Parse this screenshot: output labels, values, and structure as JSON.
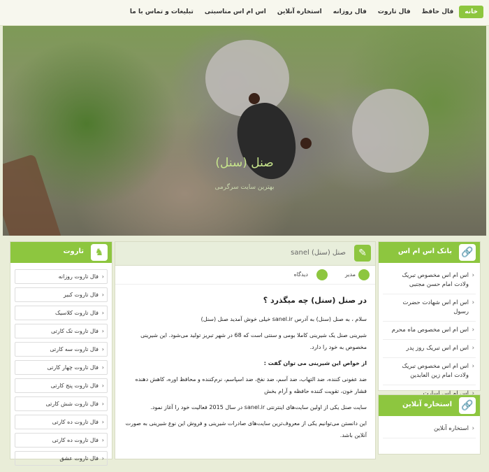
{
  "nav": {
    "items": [
      "خانه",
      "فال حافظ",
      "فال تاروت",
      "فال روزانه",
      "استخاره آنلاین",
      "اس ام اس مناسبتی",
      "تبلیغات و تماس با ما"
    ]
  },
  "hero": {
    "title": "صنل (سنل)",
    "subtitle": "بهترین سایت سرگرمی"
  },
  "right_panel_1": {
    "title": "بانک اس ام اس",
    "items": [
      "اس ام اس مخصوص تبریک ولادت امام حسن مجتبی",
      "اس ام اس شهادت حضرت رسول",
      "اس ام اس مخصوص ماه محرم",
      "اس ام اس تبریک روز پدر",
      "اس ام اس مخصوص تبریک ولادت امام زین العابدین",
      "اس ام اس اسارت"
    ]
  },
  "right_panel_2": {
    "title": "استخاره آنلاین",
    "items": [
      "استخاره آنلاین"
    ]
  },
  "left_panel": {
    "title": "تاروت",
    "items": [
      "فال تاروت روزانه",
      "فال تاروت کبیر",
      "فال تاروت کلاسیک",
      "فال تاروت تک کارتی",
      "فال تاروت سه کارتی",
      "فال تاروت چهار کارتی",
      "فال تاروت پنج کارتی",
      "فال تاروت شش کارتی",
      "فال تاروت ده کارتی",
      "فال تاروت ده کارتی",
      "فال تاروت عشق"
    ]
  },
  "post": {
    "header_title": "صنل (سنل) sanel",
    "author": "مدیر",
    "comments": "دیدگاه",
    "heading": "در صنل (سنل) چه میگذرد ؟",
    "paragraphs": [
      "سلام ، به صنل (سنل) به آدرس sanel.ir خیلی خوش آمدید صنل (سنل)",
      "شیرینی صنل یک شیرینی کاملا بومی و سنتی است که 68 در شهر تبریز تولید می‌شود. این شیرینی مخصوص به خود را دارد.",
      "از خواص این شیرینی می توان گفت :",
      "ضد عفونی کننده، ضد التهاب، ضد آسم، ضد نفخ، ضد اسپاسم، نرم‌کننده و محافظ اوره، کاهش دهنده فشار خون، تقویت کننده حافظه و آرام بخش",
      "سایت صنل یکی از اولین سایت‌های اینترنتی sanel.ir در سال 2015 فعالیت خود را آغاز نمود.",
      "این دانستن می‌توانیم یکی از معروف‌ترین سایت‌های صادرات شیرینی و فروش این نوع شیرینی به صورت آنلاین باشد."
    ]
  }
}
